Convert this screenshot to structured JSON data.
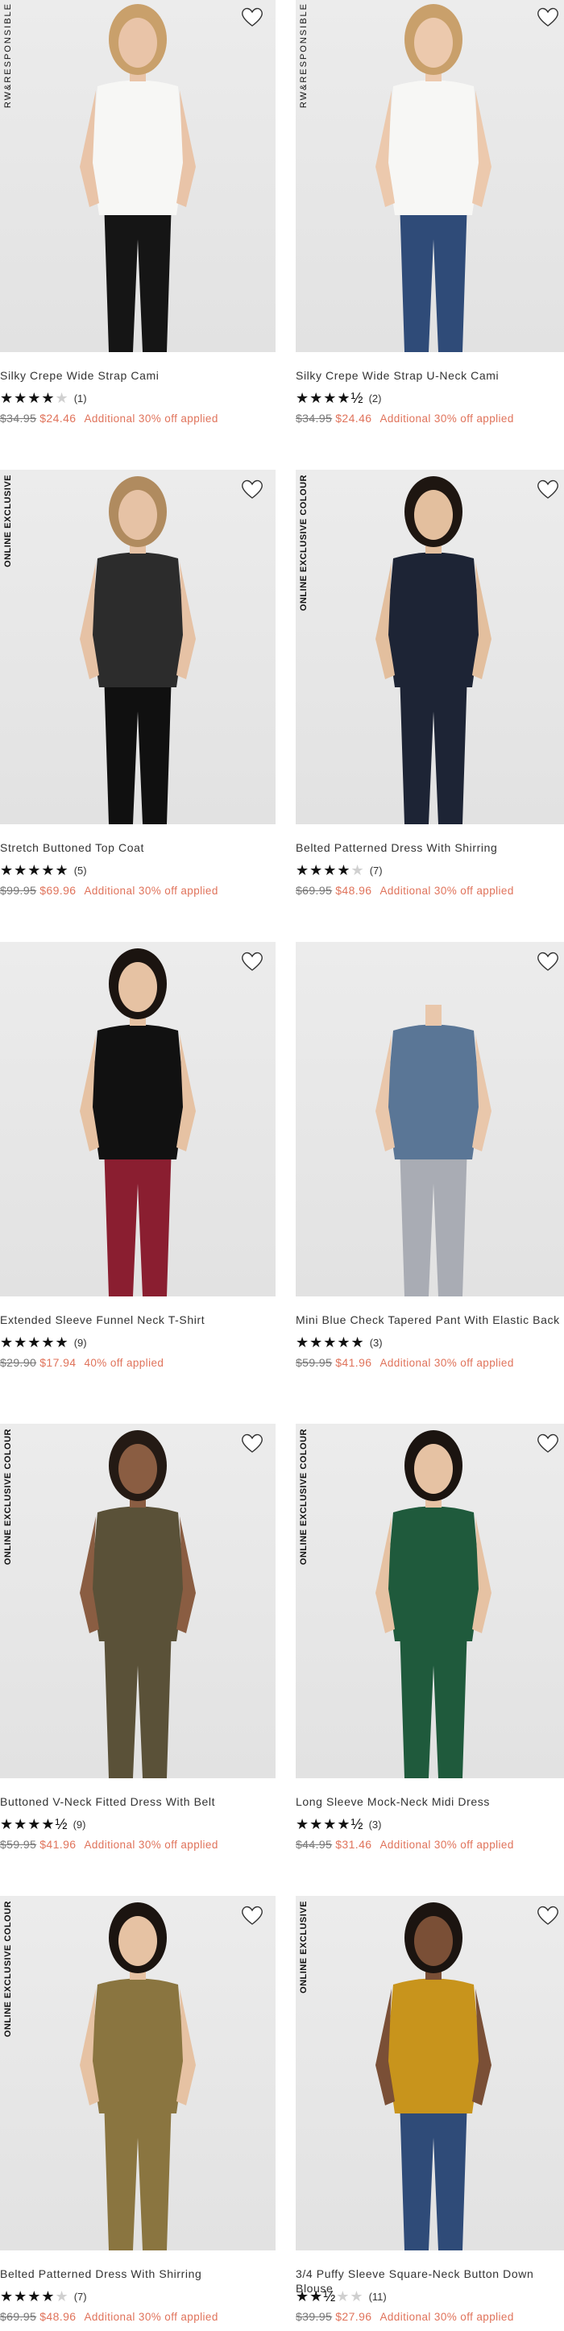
{
  "colors": {
    "sale_price": "#e0735b",
    "original_price": "#777777",
    "star_filled": "#111111",
    "star_empty": "#d0d0d0",
    "photo_background": "#e6e6e6"
  },
  "products": [
    {
      "badge": "RW&RESPONSIBLE",
      "title": "Silky Crepe Wide Strap Cami",
      "rating": 4,
      "stars": "★★★★",
      "stars_empty": "★",
      "review_count": "(1)",
      "original_price": "$34.95",
      "sale_price": "$24.46",
      "promo": "Additional 30% off applied",
      "outfit": {
        "top": "#f7f7f5",
        "bottom": "#151515",
        "hair": "#c9a06b",
        "skin": "#e9c4a8"
      }
    },
    {
      "badge": "RW&RESPONSIBLE",
      "title": "Silky Crepe Wide Strap U-Neck Cami",
      "rating": 4.5,
      "stars": "★★★★½",
      "stars_empty": "",
      "review_count": "(2)",
      "original_price": "$34.95",
      "sale_price": "$24.46",
      "promo": "Additional 30% off applied",
      "outfit": {
        "top": "#f7f7f5",
        "bottom": "#2f4b78",
        "hair": "#c9a06b",
        "skin": "#ecc9ad"
      }
    },
    {
      "badge": "ONLINE EXCLUSIVE",
      "title": "Stretch Buttoned Top Coat",
      "rating": 5,
      "stars": "★★★★★",
      "stars_empty": "",
      "review_count": "(5)",
      "original_price": "$99.95",
      "sale_price": "$69.96",
      "promo": "Additional 30% off applied",
      "outfit": {
        "top": "#2c2c2c",
        "bottom": "#101010",
        "hair": "#b08b5f",
        "skin": "#e6c2a5"
      }
    },
    {
      "badge": "ONLINE EXCLUSIVE COLOUR",
      "title": "Belted Patterned Dress With Shirring",
      "rating": 4,
      "stars": "★★★★",
      "stars_empty": "★",
      "review_count": "(7)",
      "original_price": "$69.95",
      "sale_price": "$48.96",
      "promo": "Additional 30% off applied",
      "outfit": {
        "top": "#1d2435",
        "bottom": "#1d2435",
        "hair": "#1e1611",
        "skin": "#e3bf9e"
      }
    },
    {
      "badge": "",
      "title": "Extended Sleeve Funnel Neck T-Shirt",
      "rating": 5,
      "stars": "★★★★★",
      "stars_empty": "",
      "review_count": "(9)",
      "original_price": "$29.90",
      "sale_price": "$17.94",
      "promo": "40% off applied",
      "outfit": {
        "top": "#111111",
        "bottom": "#8a1e30",
        "hair": "#1b1410",
        "skin": "#e6c2a3"
      }
    },
    {
      "badge": "",
      "title": "Mini Blue Check Tapered Pant With Elastic Back",
      "rating": 5,
      "stars": "★★★★★",
      "stars_empty": "",
      "review_count": "(3)",
      "original_price": "$59.95",
      "sale_price": "$41.96",
      "promo": "Additional 30% off applied",
      "outfit": {
        "top": "#5a7696",
        "bottom": "#a9acb4",
        "hair": "",
        "skin": "#e9c7ab"
      }
    },
    {
      "badge": "ONLINE EXCLUSIVE COLOUR",
      "title": "Buttoned V-Neck Fitted Dress With Belt",
      "rating": 4.5,
      "stars": "★★★★½",
      "stars_empty": "",
      "review_count": "(9)",
      "original_price": "$59.95",
      "sale_price": "$41.96",
      "promo": "Additional 30% off applied",
      "outfit": {
        "top": "#5a5138",
        "bottom": "#5a5138",
        "hair": "#241a14",
        "skin": "#8a5d42"
      }
    },
    {
      "badge": "ONLINE EXCLUSIVE COLOUR",
      "title": "Long Sleeve Mock-Neck Midi Dress",
      "rating": 4.5,
      "stars": "★★★★½",
      "stars_empty": "",
      "review_count": "(3)",
      "original_price": "$44.95",
      "sale_price": "$31.46",
      "promo": "Additional 30% off applied",
      "outfit": {
        "top": "#1f5a3c",
        "bottom": "#1f5a3c",
        "hair": "#1b1410",
        "skin": "#e6c2a3"
      }
    },
    {
      "badge": "ONLINE EXCLUSIVE COLOUR",
      "title": "Belted Patterned Dress With Shirring",
      "rating": 4,
      "stars": "★★★★",
      "stars_empty": "★",
      "review_count": "(7)",
      "original_price": "$69.95",
      "sale_price": "$48.96",
      "promo": "Additional 30% off applied",
      "outfit": {
        "top": "#8a7540",
        "bottom": "#8a7540",
        "hair": "#1b1410",
        "skin": "#e6c2a3"
      }
    },
    {
      "badge": "ONLINE EXCLUSIVE",
      "title": "3/4 Puffy Sleeve Square-Neck Button Down Blouse",
      "rating": 2.5,
      "stars": "★★½",
      "stars_empty": "★★",
      "review_count": "(11)",
      "original_price": "$39.95",
      "sale_price": "$27.96",
      "promo": "Additional 30% off applied",
      "outfit": {
        "top": "#c8941c",
        "bottom": "#2f4b78",
        "hair": "#1b1410",
        "skin": "#7a4f36"
      }
    }
  ]
}
